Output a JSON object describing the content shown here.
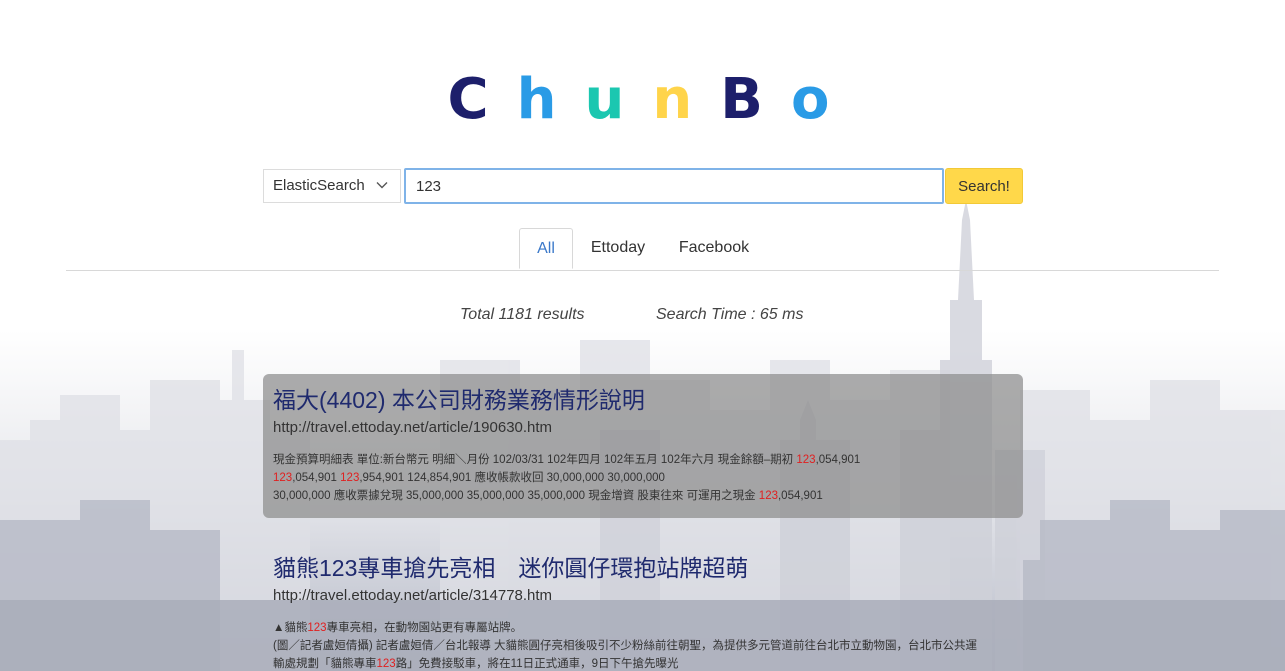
{
  "logo": {
    "letters": [
      {
        "char": "C",
        "color": "#1d1f6b"
      },
      {
        "char": "h",
        "color": "#2a9be6"
      },
      {
        "char": "u",
        "color": "#1bc7b0"
      },
      {
        "char": "n",
        "color": "#ffd44a"
      },
      {
        "char": "B",
        "color": "#1d1f6b"
      },
      {
        "char": "o",
        "color": "#2a9be6"
      }
    ]
  },
  "search": {
    "engine": "ElasticSearch",
    "query": "123",
    "button_label": "Search!"
  },
  "tabs": [
    {
      "label": "All",
      "active": true
    },
    {
      "label": "Ettoday",
      "active": false
    },
    {
      "label": "Facebook",
      "active": false
    }
  ],
  "stats": {
    "total": "Total 1181 results",
    "time": "Search Time : 65 ms"
  },
  "results": [
    {
      "title": "福大(4402) 本公司財務業務情形說明",
      "url": "http://travel.ettoday.net/article/190630.htm",
      "snippet_lines": [
        [
          {
            "t": "現金預算明細表 單位:新台幣元 明細＼月份 102/03/31 102年四月 102年五月 102年六月 現金餘額–期初 ",
            "hl": false
          },
          {
            "t": "123",
            "hl": true
          },
          {
            "t": ",054,901",
            "hl": false
          }
        ],
        [
          {
            "t": "123",
            "hl": true
          },
          {
            "t": ",054,901 ",
            "hl": false
          },
          {
            "t": "123",
            "hl": true
          },
          {
            "t": ",954,901 124,854,901 應收帳款收回 30,000,000 30,000,000",
            "hl": false
          }
        ],
        [
          {
            "t": "30,000,000 應收票據兌現 35,000,000 35,000,000 35,000,000 現金增資 股東往來 可運用之現金 ",
            "hl": false
          },
          {
            "t": "123",
            "hl": true
          },
          {
            "t": ",054,901",
            "hl": false
          }
        ]
      ]
    },
    {
      "title": "貓熊123專車搶先亮相　迷你圓仔環抱站牌超萌",
      "url": "http://travel.ettoday.net/article/314778.htm",
      "snippet_lines": [
        [
          {
            "t": "▲貓熊",
            "hl": false
          },
          {
            "t": "123",
            "hl": true
          },
          {
            "t": "專車亮相，在動物園站更有專屬站牌。",
            "hl": false
          }
        ],
        [
          {
            "t": "(圖／記者盧姮倩攝) 記者盧姮倩／台北報導 大貓熊圓仔亮相後吸引不少粉絲前往朝聖，為提供多元管道前往台北市立動物園，台北市公共運",
            "hl": false
          }
        ],
        [
          {
            "t": "輸處規劃「貓熊專車",
            "hl": false
          },
          {
            "t": "123",
            "hl": true
          },
          {
            "t": "路」免費接駁車，將在11日正式通車，9日下午搶先曝光",
            "hl": false
          }
        ]
      ]
    }
  ]
}
